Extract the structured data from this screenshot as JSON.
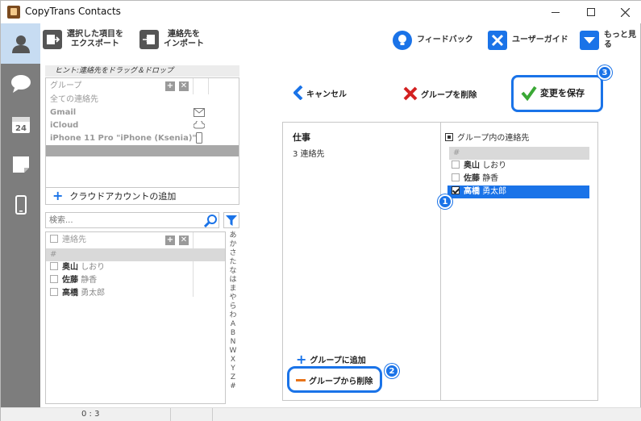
{
  "window": {
    "title": "CopyTrans Contacts"
  },
  "toolbar": {
    "export_label_1": "選択した項目を",
    "export_label_2": "エクスポート",
    "import_label_1": "連絡先を",
    "import_label_2": "インポート",
    "feedback_label": "フィードバック",
    "guide_label": "ユーザーガイド",
    "more_label": "もっと見る"
  },
  "hint": "ヒント:連絡先をドラッグ＆ドロップ",
  "accounts": {
    "header": "グループ",
    "all_contacts": "全ての連絡先",
    "items": [
      {
        "label": "Gmail",
        "icon": "mail-icon"
      },
      {
        "label": "iCloud",
        "icon": "cloud-icon"
      },
      {
        "label": "iPhone 11 Pro \"iPhone (Ksenia)\"",
        "icon": "phone-icon"
      }
    ],
    "add_cloud_label": "クラウドアカウントの追加"
  },
  "search": {
    "placeholder": "検索..."
  },
  "contacts_list": {
    "header": "連絡先",
    "hash": "#",
    "rows": [
      {
        "last": "奥山",
        "first": "しおり"
      },
      {
        "last": "佐藤",
        "first": "静香"
      },
      {
        "last": "高橋",
        "first": "勇太郎"
      }
    ]
  },
  "alphabet": [
    "あ",
    "か",
    "さ",
    "た",
    "な",
    "は",
    "ま",
    "や",
    "ら",
    "わ",
    "A",
    "B",
    "N",
    "W",
    "X",
    "Y",
    "Z",
    "#"
  ],
  "actions": {
    "cancel_label": "キャンセル",
    "delete_group_label": "グループを削除",
    "save_label": "変更を保存",
    "add_to_group_label": "グループに追加",
    "remove_from_group_label": "グループから削除"
  },
  "group_detail": {
    "name": "仕事",
    "count": "3 連絡先"
  },
  "group_members": {
    "header": "グループ内の連絡先",
    "hash": "#",
    "rows": [
      {
        "last": "奥山",
        "first": "しおり",
        "checked": false
      },
      {
        "last": "佐藤",
        "first": "静香",
        "checked": false
      },
      {
        "last": "高橋",
        "first": "勇太郎",
        "checked": true
      }
    ]
  },
  "badges": {
    "one": "1",
    "two": "2",
    "three": "3"
  },
  "status": {
    "count": "0 : 3"
  },
  "colors": {
    "accent": "#1a73e8",
    "nav_bg": "#7d7d7d",
    "nav_active": "#c7dcf2",
    "selected_row": "#1a73e8"
  }
}
